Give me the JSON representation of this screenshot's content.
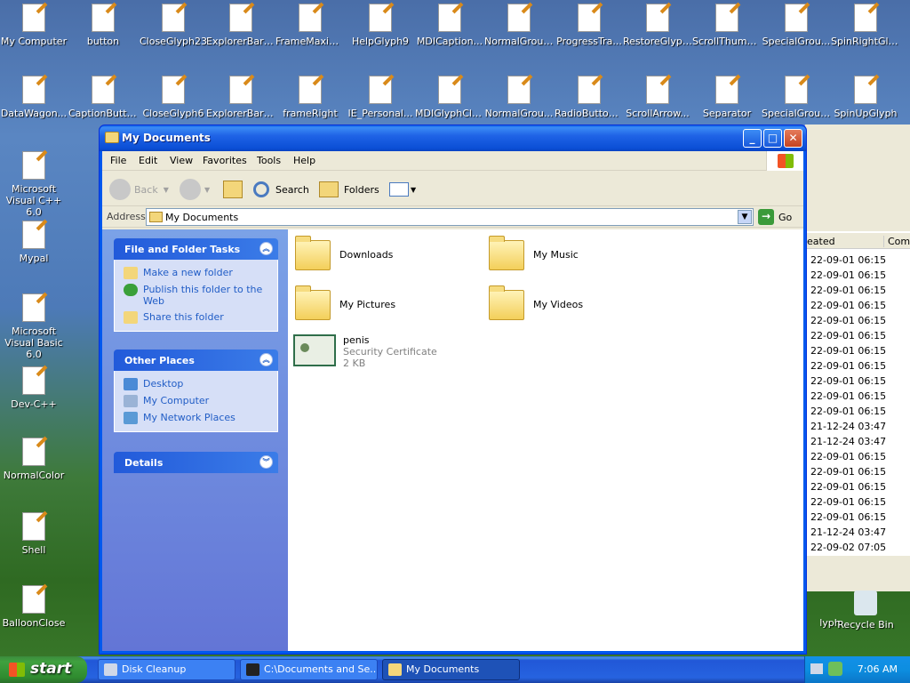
{
  "desktop": {
    "row1": [
      "My Computer",
      "button",
      "CloseGlyph23",
      "ExplorerBarT...",
      "FrameMaxim...",
      "HelpGlyph9",
      "MDICaption...",
      "NormalGroup...",
      "ProgressTra...",
      "RestoreGlyph9",
      "ScrollThumb...",
      "SpecialGrou...",
      "SpinRightGlyph"
    ],
    "row2": [
      "DataWagon...",
      "CaptionButton",
      "CloseGlyph6",
      "ExplorerBarT...",
      "frameRight",
      "IE_Personal...",
      "MDIGlyphClose",
      "NormalGrou...",
      "RadioButton13",
      "ScrollArrow...",
      "Separator",
      "SpecialGroup...",
      "SpinUpGlyph"
    ],
    "left_col": [
      "Microsoft Visual C++ 6.0",
      "Mypal",
      "Microsoft Visual Basic 6.0",
      "Dev-C++",
      "NormalColor",
      "Shell",
      "BalloonClose"
    ],
    "right_partial": [
      "lyph",
      "Recycle Bin"
    ]
  },
  "bg_window": {
    "headers": [
      "eated",
      "Comm"
    ],
    "rows": [
      "22-09-01 06:15",
      "22-09-01 06:15",
      "22-09-01 06:15",
      "22-09-01 06:15",
      "22-09-01 06:15",
      "22-09-01 06:15",
      "22-09-01 06:15",
      "22-09-01 06:15",
      "22-09-01 06:15",
      "22-09-01 06:15",
      "22-09-01 06:15",
      "21-12-24 03:47",
      "21-12-24 03:47",
      "22-09-01 06:15",
      "22-09-01 06:15",
      "22-09-01 06:15",
      "22-09-01 06:15",
      "22-09-01 06:15",
      "21-12-24 03:47",
      "22-09-02 07:05"
    ]
  },
  "window": {
    "title": "My Documents",
    "menu": [
      "File",
      "Edit",
      "View",
      "Favorites",
      "Tools",
      "Help"
    ],
    "toolbar": {
      "back": "Back",
      "search": "Search",
      "folders": "Folders"
    },
    "address": {
      "label": "Address",
      "value": "My Documents",
      "go": "Go"
    },
    "tasks": {
      "file_folder": {
        "title": "File and Folder Tasks",
        "items": [
          "Make a new folder",
          "Publish this folder to the Web",
          "Share this folder"
        ]
      },
      "other_places": {
        "title": "Other Places",
        "items": [
          "Desktop",
          "My Computer",
          "My Network Places"
        ]
      },
      "details": {
        "title": "Details"
      }
    },
    "files": [
      {
        "name": "Downloads"
      },
      {
        "name": "My Music"
      },
      {
        "name": "My Pictures"
      },
      {
        "name": "My Videos"
      },
      {
        "name": "penis",
        "type": "Security Certificate",
        "size": "2 KB"
      }
    ]
  },
  "taskbar": {
    "start": "start",
    "buttons": [
      "Disk Cleanup",
      "C:\\Documents and Se...",
      "My Documents"
    ],
    "clock": "7:06 AM"
  }
}
